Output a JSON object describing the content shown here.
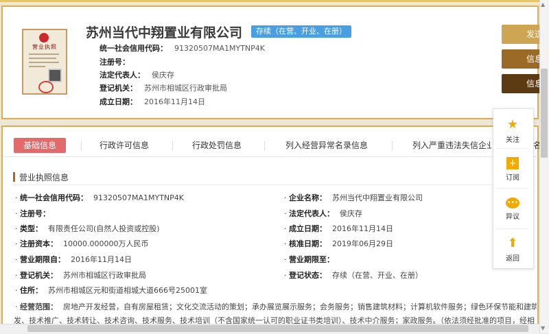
{
  "company": {
    "name": "苏州当代中翔置业有限公司",
    "status": "存续（在营、开业、在册）",
    "fields": [
      {
        "label": "统一社会信用代码：",
        "value": "91320507MA1MYTNP4K"
      },
      {
        "label": "注册号：",
        "value": ""
      },
      {
        "label": "法定代表人：",
        "value": "侯庆存"
      },
      {
        "label": "登记机关：",
        "value": "苏州市相城区行政审批局"
      },
      {
        "label": "成立日期：",
        "value": "2016年11月14日"
      }
    ]
  },
  "certificate": {
    "title": "营业执照"
  },
  "side_buttons": [
    {
      "label": "发送",
      "color": "#cfa554"
    },
    {
      "label": "信息",
      "color": "#9b6a26"
    },
    {
      "label": "信息",
      "color": "#5c3a12"
    }
  ],
  "tabs": [
    "基础信息",
    "行政许可信息",
    "行政处罚信息",
    "列入经营异常名录信息",
    "列入严重违法失信企业名单信息"
  ],
  "tab_cut": [
    "名"
  ],
  "section": {
    "title": "营业执照信息"
  },
  "license": {
    "left": [
      {
        "label": "统一社会信用代码：",
        "value": "91320507MA1MYTNP4K"
      },
      {
        "label": "注册号：",
        "value": ""
      },
      {
        "label": "类型：",
        "value": "有限责任公司(自然人投资或控股)"
      },
      {
        "label": "注册资本：",
        "value": "10000.000000万人民币"
      },
      {
        "label": "营业期限自：",
        "value": "2016年11月14日"
      },
      {
        "label": "登记机关：",
        "value": "苏州市相城区行政审批局"
      },
      {
        "label": "住所：",
        "value": "苏州市相城区元和街道相城大道666号25001室"
      }
    ],
    "right": [
      {
        "label": "企业名称：",
        "value": "苏州当代中翔置业有限公司"
      },
      {
        "label": "法定代表人：",
        "value": "侯庆存"
      },
      {
        "label": "成立日期：",
        "value": "2016年11月14日"
      },
      {
        "label": "核准日期：",
        "value": "2019年06月29日"
      },
      {
        "label": "营业期限至：",
        "value": ""
      },
      {
        "label": "登记状态：",
        "value": "存续（在营、开业、在册）"
      }
    ],
    "scope_label": "经营范围：",
    "scope_line1": "房地产开发经营，自有房屋租赁；文化交流活动的策划；承办展览展示服务；会务服务；销售建筑材料；计算机软件服务；绿色环保节能和建筑",
    "scope_line2": "发、技术推广、技术转让、技术咨询、技术服务、技术培训（不含国家统一认可的职业证书类培训）、技术中介服务；家政服务。（依法须经批准的项目，经相"
  },
  "float_panel": [
    {
      "label": "关注",
      "icon": "star-icon"
    },
    {
      "label": "订阅",
      "icon": "plus-square-icon"
    },
    {
      "label": "异议",
      "icon": "chat-bubble-icon"
    },
    {
      "label": "返回",
      "icon": "arrow-up-icon"
    }
  ],
  "colors": {
    "gold": "#d8ae53",
    "tab_active": "#e36a6a",
    "status_tag": "#4a9fe3",
    "float_icon": "#f2a900"
  }
}
